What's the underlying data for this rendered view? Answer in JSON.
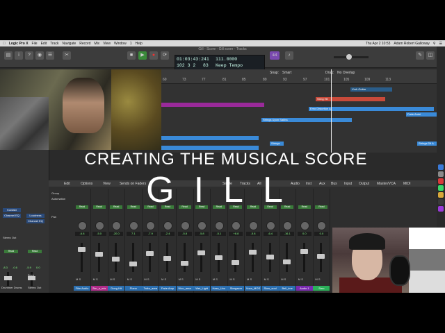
{
  "menubar": {
    "app": "Logic Pro X",
    "items": [
      "File",
      "Edit",
      "Track",
      "Navigate",
      "Record",
      "Mix",
      "View",
      "Window",
      "1",
      "Help"
    ],
    "datetime": "Thu Apr 2  10:53",
    "user": "Adam Robert Galloway"
  },
  "window": {
    "title": "Gill - Score - Gill score - Tracks"
  },
  "lcd": {
    "time": "01:03:43:241",
    "bars": "102  3  2",
    "beat_sub": "83",
    "tempo": "111.0000",
    "tempo_mode": "Keep Tempo",
    "key": "4/4"
  },
  "edit": {
    "snap_label": "Snap:",
    "snap_value": "Smart",
    "drag_label": "Drag:",
    "drag_value": "No Overlap"
  },
  "ruler": {
    "ticks": [
      "69",
      "73",
      "77",
      "81",
      "85",
      "89",
      "93",
      "97",
      "101",
      "105",
      "109",
      "113"
    ]
  },
  "regions": [
    {
      "label": "Strng Hit",
      "color": "#c84a3a"
    },
    {
      "label": "Vmh Guitar",
      "color": "#2a5d8a"
    },
    {
      "label": "Emo Distortion A",
      "color": "#3a8ad8"
    },
    {
      "label": "Fade Ambi",
      "color": "#3a8ad8"
    },
    {
      "label": "Strings Upon Sakha",
      "color": "#3a8ad8"
    },
    {
      "label": "Strings",
      "color": "#3a8ad8"
    },
    {
      "label": "Strings Dil A",
      "color": "#3a8ad8"
    },
    {
      "label": "",
      "color": "#9a2a9a"
    }
  ],
  "inspector": {
    "plugin1": "Kontakt",
    "plugin2": "Channel EQ",
    "plugin3": "Loudness",
    "plugin4": "Channel EQ",
    "output": "Stereo Out",
    "read": "Read",
    "vals": [
      "-8.3",
      "-0.6",
      "-5.9",
      "0.0"
    ],
    "labels": [
      "Drummer Drums",
      "Stereo Out"
    ],
    "bnce": "Bnce"
  },
  "mixer": {
    "menu": [
      "Edit",
      "Options",
      "View",
      "Sends on Faders"
    ],
    "tabs": [
      "Single",
      "Tracks",
      "All"
    ],
    "filters": [
      "Audio",
      "Inst",
      "Aux",
      "Bus",
      "Input",
      "Output",
      "Master/VCA",
      "MIDI"
    ],
    "row_labels": [
      "Group",
      "Automation",
      "Pan"
    ],
    "strips": [
      {
        "name": "Film Audio",
        "val": "-6.8",
        "read": "Read",
        "color": "#2b6fb0"
      },
      {
        "name": "Zim_o_mix",
        "val": "-5.0",
        "read": "Read",
        "color": "#b02b8a"
      },
      {
        "name": "Dong Hit",
        "val": "-20.0",
        "read": "Read",
        "color": "#2b6fb0"
      },
      {
        "name": "Piano",
        "val": "7.1",
        "read": "Read",
        "color": "#2b6fb0"
      },
      {
        "name": "Taiko_area",
        "val": "-7.9",
        "read": "Read",
        "color": "#2b6fb0"
      },
      {
        "name": "Fade Amp",
        "val": "-2.4",
        "read": "Read",
        "color": "#2b6fb0"
      },
      {
        "name": "Woo_area",
        "val": "-5.8",
        "read": "Read",
        "color": "#2b6fb0"
      },
      {
        "name": "Wet_Light",
        "val": "-5.8",
        "read": "Read",
        "color": "#2b6fb0"
      },
      {
        "name": "Hass_Uou",
        "val": "-5.1",
        "read": "Read",
        "color": "#2b6fb0"
      },
      {
        "name": "Stergazer",
        "val": "+8.8",
        "read": "Read",
        "color": "#2b6fb0"
      },
      {
        "name": "Voca_MOS",
        "val": "-5.8",
        "read": "Read",
        "color": "#2b6fb0"
      },
      {
        "name": "Slow_soul",
        "val": "-6.4",
        "read": "Read",
        "color": "#2b6fb0"
      },
      {
        "name": "Bell_ime",
        "val": "-16.1",
        "read": "Read",
        "color": "#2b6fb0"
      },
      {
        "name": "Audio 1",
        "val": "0.0",
        "read": "Read",
        "color": "#7a2bb0"
      },
      {
        "name": "Smo",
        "val": "0.0",
        "read": "Read",
        "color": "#2bb05a"
      }
    ]
  },
  "overlay": {
    "subtitle": "CREATING THE MUSICAL SCORE",
    "title": "GILL"
  }
}
